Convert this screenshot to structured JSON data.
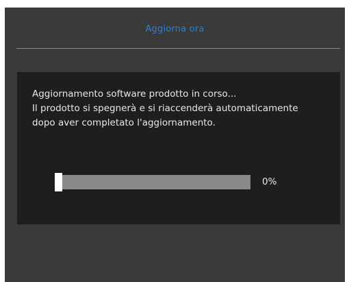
{
  "dialog": {
    "title": "Aggiorna ora",
    "message_lines": [
      "Aggiornamento software prodotto in corso...",
      "Il prodotto si spegnerà e si riaccenderà automaticamente",
      "dopo aver completato l'aggiornamento."
    ]
  },
  "progress": {
    "percent": 0,
    "label": "0%"
  },
  "colors": {
    "title_accent": "#2f7fd0",
    "osd_background": "#3a3a3a",
    "panel_background": "#1e1e1e",
    "progress_track": "#8a8a8a",
    "progress_fill": "#ffffff"
  }
}
